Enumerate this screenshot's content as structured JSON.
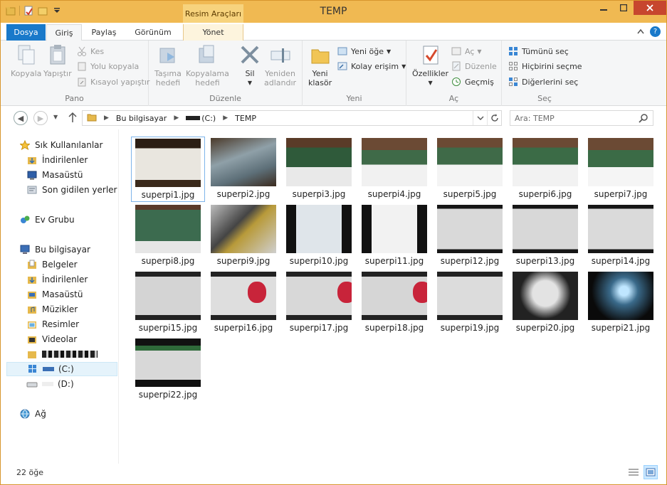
{
  "window": {
    "title": "TEMP",
    "context_tab": "Resim Araçları"
  },
  "tabs": [
    {
      "label": "Dosya"
    },
    {
      "label": "Giriş"
    },
    {
      "label": "Paylaş"
    },
    {
      "label": "Görünüm"
    },
    {
      "label": "Yönet"
    }
  ],
  "ribbon": {
    "pano": {
      "label": "Pano",
      "copy": "Kopyala",
      "paste": "Yapıştır",
      "cut": "Kes",
      "copy_path": "Yolu kopyala",
      "paste_shortcut": "Kısayol yapıştır"
    },
    "duzenle": {
      "label": "Düzenle",
      "move_to_1": "Taşıma",
      "move_to_2": "hedefi",
      "copy_to_1": "Kopyalama",
      "copy_to_2": "hedefi",
      "delete": "Sil",
      "rename_1": "Yeniden",
      "rename_2": "adlandır"
    },
    "yeni": {
      "label": "Yeni",
      "new_folder_1": "Yeni",
      "new_folder_2": "klasör",
      "new_item": "Yeni öğe",
      "easy_access": "Kolay erişim"
    },
    "ac": {
      "label": "Aç",
      "properties": "Özellikler",
      "open": "Aç",
      "edit": "Düzenle",
      "history": "Geçmiş"
    },
    "sec": {
      "label": "Seç",
      "select_all": "Tümünü seç",
      "select_none": "Hiçbirini seçme",
      "invert": "Diğerlerini seç"
    }
  },
  "address": {
    "crumbs": [
      "Bu bilgisayar",
      "(C:)",
      "TEMP"
    ],
    "search_placeholder": "Ara: TEMP"
  },
  "nav": {
    "favorites": "Sık Kullanılanlar",
    "downloads": "İndirilenler",
    "desktop": "Masaüstü",
    "recent": "Son gidilen yerler",
    "homegroup": "Ev Grubu",
    "this_pc": "Bu bilgisayar",
    "documents": "Belgeler",
    "pc_downloads": "İndirilenler",
    "pc_desktop": "Masaüstü",
    "music": "Müzikler",
    "pictures": "Resimler",
    "videos": "Videolar",
    "drive_c": "(C:)",
    "drive_d": "(D:)",
    "network": "Ağ"
  },
  "files": [
    "superpi1.jpg",
    "superpi2.jpg",
    "superpi3.jpg",
    "superpi4.jpg",
    "superpi5.jpg",
    "superpi6.jpg",
    "superpi7.jpg",
    "superpi8.jpg",
    "superpi9.jpg",
    "superpi10.jpg",
    "superpi11.jpg",
    "superpi12.jpg",
    "superpi13.jpg",
    "superpi14.jpg",
    "superpi15.jpg",
    "superpi16.jpg",
    "superpi17.jpg",
    "superpi18.jpg",
    "superpi19.jpg",
    "superpi20.jpg",
    "superpi21.jpg",
    "superpi22.jpg"
  ],
  "status": {
    "count": "22 öğe"
  },
  "colors": {
    "titlebar": "#f0b952",
    "file_tab": "#1979ca",
    "close": "#c7462e"
  }
}
